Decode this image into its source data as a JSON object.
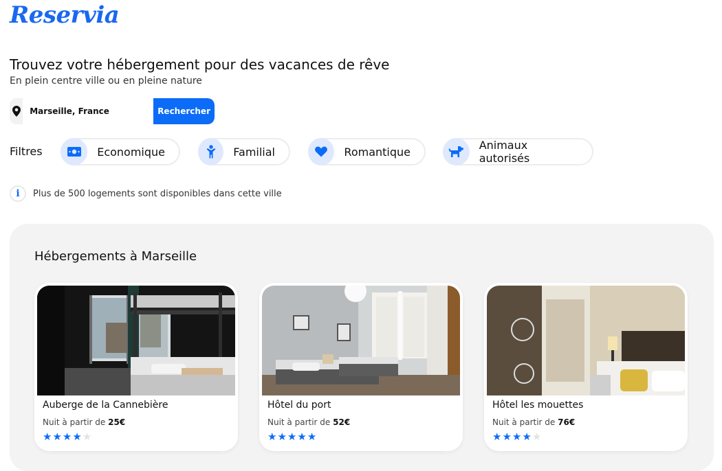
{
  "brand": {
    "logo": "Reservia"
  },
  "hero": {
    "title": "Trouvez votre hébergement pour des vacances de rêve",
    "subtitle": "En plein centre ville ou en pleine nature"
  },
  "search": {
    "icon": "location-pin-icon",
    "value": "Marseille, France",
    "button_label": "Rechercher"
  },
  "filters": {
    "label": "Filtres",
    "items": [
      {
        "label": "Economique",
        "icon": "money-icon"
      },
      {
        "label": "Familial",
        "icon": "child-icon"
      },
      {
        "label": "Romantique",
        "icon": "heart-icon"
      },
      {
        "label": "Animaux autorisés",
        "icon": "dog-icon"
      }
    ]
  },
  "info": {
    "icon": "info-icon",
    "text": "Plus de 500 logements sont disponibles dans cette ville"
  },
  "listings": {
    "title": "Hébergements à Marseille",
    "price_prefix": "Nuit à partir de",
    "items": [
      {
        "name": "Auberge de la Cannebière",
        "price": "25€",
        "rating": 4,
        "max_rating": 5
      },
      {
        "name": "Hôtel du port",
        "price": "52€",
        "rating": 5,
        "max_rating": 5
      },
      {
        "name": "Hôtel les mouettes",
        "price": "76€",
        "rating": 4,
        "max_rating": 5
      }
    ]
  },
  "colors": {
    "accent": "#0c6cf7",
    "chip_bg": "#dfe9fd",
    "panel_bg": "#f3f3f3"
  }
}
